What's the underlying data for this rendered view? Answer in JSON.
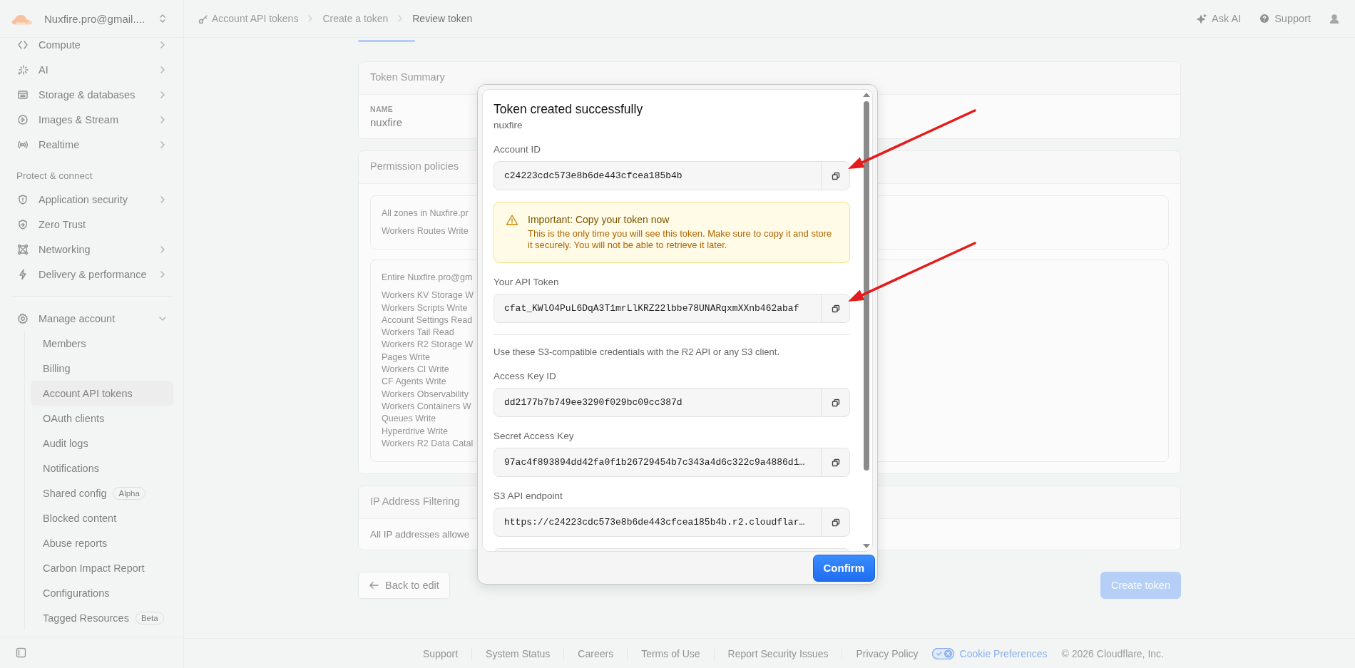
{
  "sidebar": {
    "account_name": "Nuxfire.pro@gmail....",
    "groups": [
      {
        "items": [
          {
            "label": "Compute",
            "expanded": false
          },
          {
            "label": "AI",
            "expanded": false
          },
          {
            "label": "Storage & databases",
            "expanded": false
          },
          {
            "label": "Images & Stream",
            "expanded": false
          },
          {
            "label": "Realtime",
            "expanded": false
          }
        ]
      },
      {
        "heading": "Protect & connect",
        "items": [
          {
            "label": "Application security",
            "expanded": false
          },
          {
            "label": "Zero Trust"
          },
          {
            "label": "Networking",
            "expanded": false
          },
          {
            "label": "Delivery & performance",
            "expanded": false
          }
        ]
      },
      {
        "items": [
          {
            "label": "Manage account",
            "expanded": true,
            "children": [
              {
                "label": "Members",
                "selected": false
              },
              {
                "label": "Billing",
                "selected": false
              },
              {
                "label": "Account API tokens",
                "selected": true
              },
              {
                "label": "OAuth clients",
                "selected": false
              },
              {
                "label": "Audit logs",
                "selected": false
              },
              {
                "label": "Notifications",
                "selected": false
              },
              {
                "label": "Shared config",
                "badge": "Alpha",
                "selected": false
              },
              {
                "label": "Blocked content",
                "selected": false
              },
              {
                "label": "Abuse reports",
                "selected": false
              },
              {
                "label": "Carbon Impact Report",
                "selected": false
              },
              {
                "label": "Configurations",
                "selected": false
              },
              {
                "label": "Tagged Resources",
                "badge": "Beta",
                "selected": false
              }
            ]
          }
        ]
      }
    ]
  },
  "breadcrumb": [
    {
      "label": "Account API tokens",
      "current": false
    },
    {
      "label": "Create a token",
      "current": false
    },
    {
      "label": "Review token",
      "current": true
    }
  ],
  "top_actions": [
    {
      "kind": "ai",
      "label": "Ask AI"
    },
    {
      "kind": "help",
      "label": "Support"
    },
    {
      "kind": "user"
    }
  ],
  "page": {
    "token_summary": {
      "title": "Token Summary",
      "name_label": "NAME",
      "name": "nuxfire"
    },
    "permission_policies": {
      "title": "Permission policies",
      "policies": [
        {
          "scope": "All zones in Nuxfire.pr",
          "permissions": [
            "Workers Routes Write"
          ]
        },
        {
          "scope": "Entire Nuxfire.pro@gm",
          "permissions": [
            "Workers KV Storage W",
            "Workers Scripts Write",
            "Account Settings Read",
            "Workers Tail Read",
            "Workers R2 Storage W",
            "Pages Write",
            "Workers CI Write",
            "CF Agents Write",
            "Workers Observability",
            "Workers Containers W",
            "Queues Write",
            "Hyperdrive Write",
            "Workers R2 Data Catal"
          ]
        }
      ]
    },
    "ip_filtering": {
      "title": "IP Address Filtering",
      "text": "All IP addresses allowe"
    },
    "actions": [
      {
        "kind": "back",
        "label": "Back to edit"
      },
      {
        "kind": "primary",
        "label": "Create token",
        "disabled": true
      }
    ]
  },
  "modal": {
    "title": "Token created successfully",
    "subtitle": "nuxfire",
    "items": [
      {
        "kind": "field",
        "label": "Account ID",
        "value": "c24223cdc573e8b6de443cfcea185b4b",
        "annotated": true
      },
      {
        "kind": "warning",
        "title": "Important: Copy your token now",
        "text": "This is the only time you will see this token. Make sure to copy it and store it securely. You will not be able to retrieve it later."
      },
      {
        "kind": "field",
        "label": "Your API Token",
        "value": "cfat_KWlO4PuL6DqA3T1mrLlKRZ22lbbe78UNARqxmXXnb462abaf",
        "annotated": true
      },
      {
        "kind": "note",
        "text": "Use these S3-compatible credentials with the R2 API or any S3 client."
      },
      {
        "kind": "field",
        "label": "Access Key ID",
        "value": "dd2177b7b749ee3290f029bc09cc387d",
        "annotated": false
      },
      {
        "kind": "field",
        "label": "Secret Access Key",
        "value": "97ac4f893894dd42fa0f1b26729454b7c343a4d6c322c9a4886d1…",
        "annotated": false
      },
      {
        "kind": "field",
        "label": "S3 API endpoint",
        "value": "https://c24223cdc573e8b6de443cfcea185b4b.r2.cloudflar…",
        "annotated": false
      },
      {
        "kind": "cut_field"
      }
    ],
    "confirm": "Confirm"
  },
  "footer": {
    "links": [
      "Support",
      "System Status",
      "Careers",
      "Terms of Use",
      "Report Security Issues",
      "Privacy Policy"
    ],
    "cookie_preferences": "Cookie Preferences",
    "copyright": "© 2026 Cloudflare, Inc."
  }
}
